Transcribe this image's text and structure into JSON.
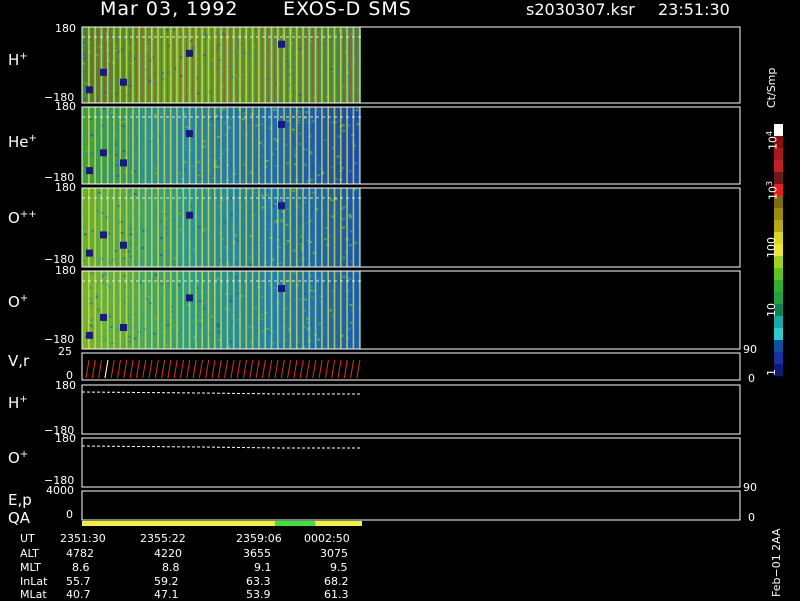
{
  "header": {
    "date": "Mar 03, 1992",
    "mission": "EXOS-D SMS",
    "file": "s2030307.ksr",
    "time": "23:51:30"
  },
  "colorbar": {
    "unit": "Ct/Smp",
    "labels": [
      "1",
      "10",
      "100",
      "10",
      "4",
      "3"
    ]
  },
  "panels": [
    {
      "species": "H",
      "charge": "+",
      "ymax": "180",
      "ymin": "−180"
    },
    {
      "species": "He",
      "charge": "+",
      "ymax": "180",
      "ymin": "−180"
    },
    {
      "species": "O",
      "charge": "++",
      "ymax": "180",
      "ymin": "−180"
    },
    {
      "species": "O",
      "charge": "+",
      "ymax": "180",
      "ymin": "−180"
    }
  ],
  "vr_panel": {
    "label": "V,r",
    "ymax": "25",
    "ymin": "0",
    "rmax": "90",
    "rmin": "0"
  },
  "line_panels": [
    {
      "species": "H",
      "charge": "+",
      "ymax": "180",
      "ymin": "−180"
    },
    {
      "species": "O",
      "charge": "+",
      "ymax": "180",
      "ymin": "−180"
    }
  ],
  "ep_panel": {
    "label": "E,p",
    "ymax": "4000",
    "ymin": "0",
    "rmax": "90",
    "rmin": "0"
  },
  "qa_label": "QA",
  "table": {
    "rows": [
      {
        "name": "UT",
        "values": [
          "2351:30",
          "2355:22",
          "2359:06",
          "0002:50"
        ]
      },
      {
        "name": "ALT",
        "values": [
          "4782",
          "4220",
          "3655",
          "3075"
        ]
      },
      {
        "name": "MLT",
        "values": [
          "8.6",
          "8.8",
          "9.1",
          "9.5"
        ]
      },
      {
        "name": "InLat",
        "values": [
          "55.7",
          "59.2",
          "63.3",
          "68.2"
        ]
      },
      {
        "name": "MLat",
        "values": [
          "40.7",
          "47.1",
          "53.9",
          "61.3"
        ]
      }
    ]
  },
  "footer": "Feb−01 2AA",
  "colors": {
    "background": "#000000",
    "axis": "#ffffff",
    "qa_yellow": "#f0f040",
    "qa_green": "#40e040",
    "velocity_red": "#e03020"
  },
  "chart_data": {
    "type": "heatmap",
    "x_ut": [
      "2351:30",
      "2355:22",
      "2359:06",
      "0002:50"
    ],
    "y_range": [
      -180,
      180
    ],
    "colorbar_scale": "log",
    "colorbar_range": [
      1,
      10000
    ],
    "qa_segments": [
      {
        "from": "2351:30",
        "to": "0001:10",
        "status": "yellow"
      },
      {
        "from": "0001:10",
        "to": "0002:20",
        "status": "green"
      },
      {
        "from": "0002:20",
        "to": "0004:00",
        "status": "yellow"
      }
    ]
  }
}
